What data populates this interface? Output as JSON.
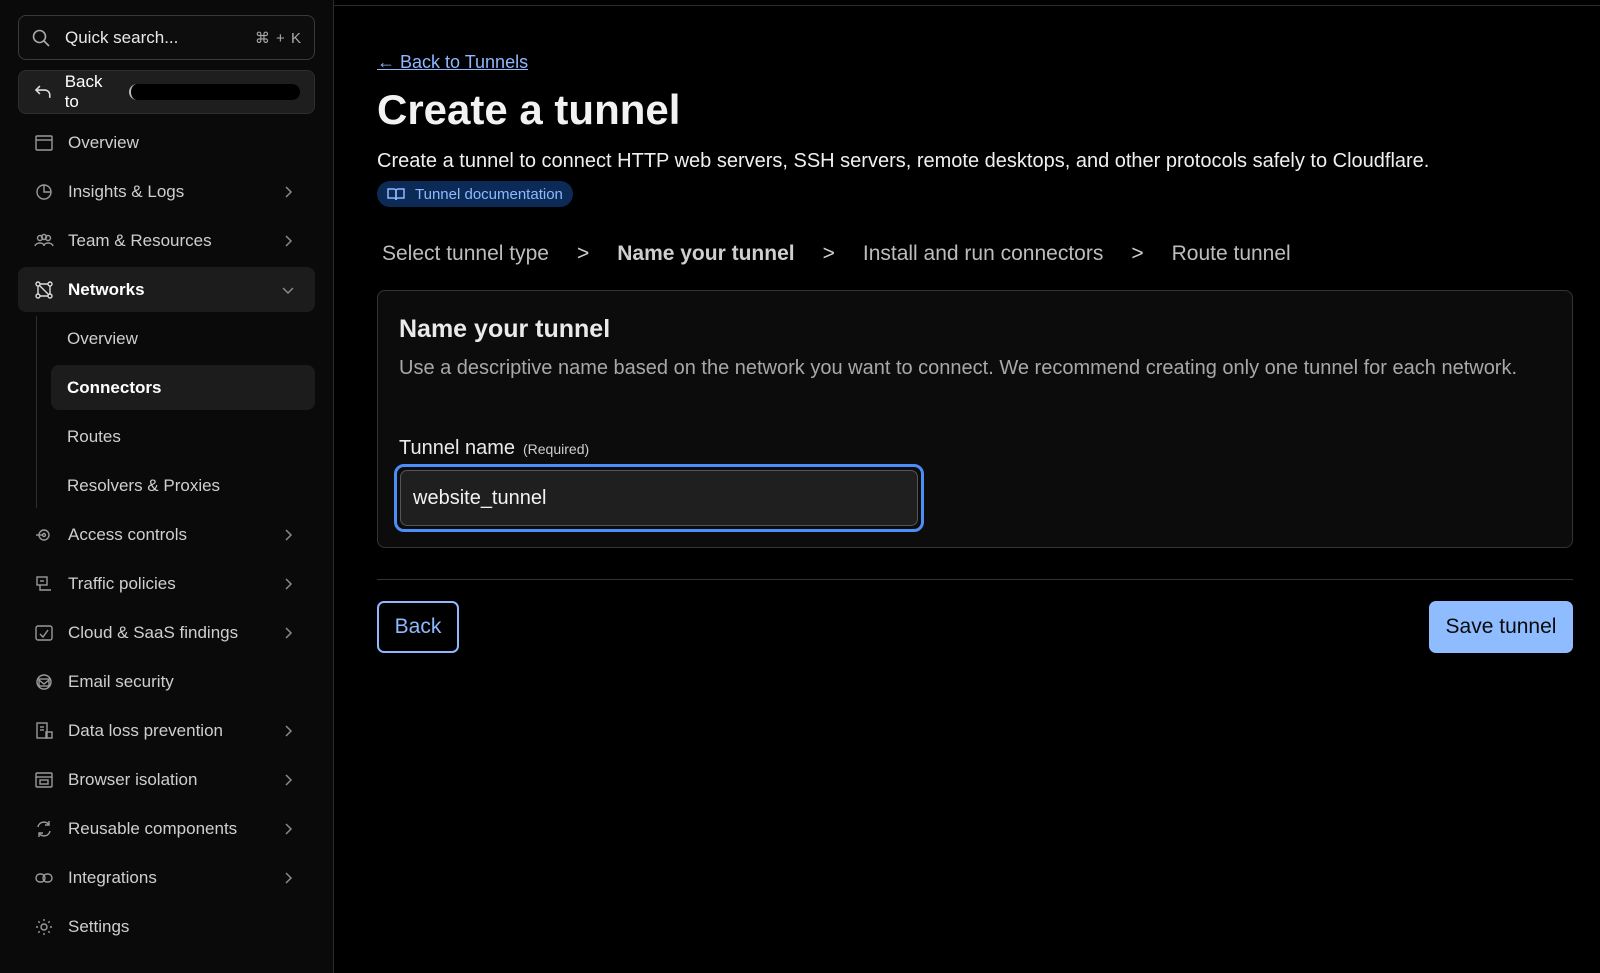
{
  "sidebar": {
    "search": {
      "placeholder": "Quick search...",
      "shortcut": "⌘ + K"
    },
    "back_to_label": "Back to",
    "items": [
      {
        "label": "Overview",
        "icon": "window-icon",
        "chevron": false
      },
      {
        "label": "Insights & Logs",
        "icon": "pie-chart-icon",
        "chevron": true
      },
      {
        "label": "Team & Resources",
        "icon": "users-icon",
        "chevron": true
      },
      {
        "label": "Networks",
        "icon": "network-icon",
        "chevron": true,
        "active": true
      }
    ],
    "networks_sub": [
      {
        "label": "Overview"
      },
      {
        "label": "Connectors",
        "active": true
      },
      {
        "label": "Routes"
      },
      {
        "label": "Resolvers & Proxies"
      }
    ],
    "items_after": [
      {
        "label": "Access controls",
        "icon": "access-icon",
        "chevron": true
      },
      {
        "label": "Traffic policies",
        "icon": "traffic-icon",
        "chevron": true
      },
      {
        "label": "Cloud & SaaS findings",
        "icon": "cloud-check-icon",
        "chevron": true
      },
      {
        "label": "Email security",
        "icon": "email-security-icon",
        "chevron": false
      },
      {
        "label": "Data loss prevention",
        "icon": "dlp-icon",
        "chevron": true
      },
      {
        "label": "Browser isolation",
        "icon": "browser-icon",
        "chevron": true
      },
      {
        "label": "Reusable components",
        "icon": "refresh-icon",
        "chevron": true
      },
      {
        "label": "Integrations",
        "icon": "link-icon",
        "chevron": true
      },
      {
        "label": "Settings",
        "icon": "gear-icon",
        "chevron": false
      }
    ]
  },
  "main": {
    "back_link": "← Back to Tunnels",
    "title": "Create a tunnel",
    "description": "Create a tunnel to connect HTTP web servers, SSH servers, remote desktops, and other protocols safely to Cloudflare.",
    "doc_badge": "Tunnel documentation",
    "steps": [
      "Select tunnel type",
      "Name your tunnel",
      "Install and run connectors",
      "Route tunnel"
    ],
    "step_separator": ">",
    "card": {
      "title": "Name your tunnel",
      "description": "Use a descriptive name based on the network you want to connect. We recommend creating only one tunnel for each network.",
      "field_label": "Tunnel name",
      "field_required": "(Required)",
      "field_value": "website_tunnel"
    },
    "buttons": {
      "back": "Back",
      "save": "Save tunnel"
    }
  },
  "colors": {
    "accent": "#8fb8ff",
    "focus": "#4b8ef5",
    "background": "#000000"
  }
}
